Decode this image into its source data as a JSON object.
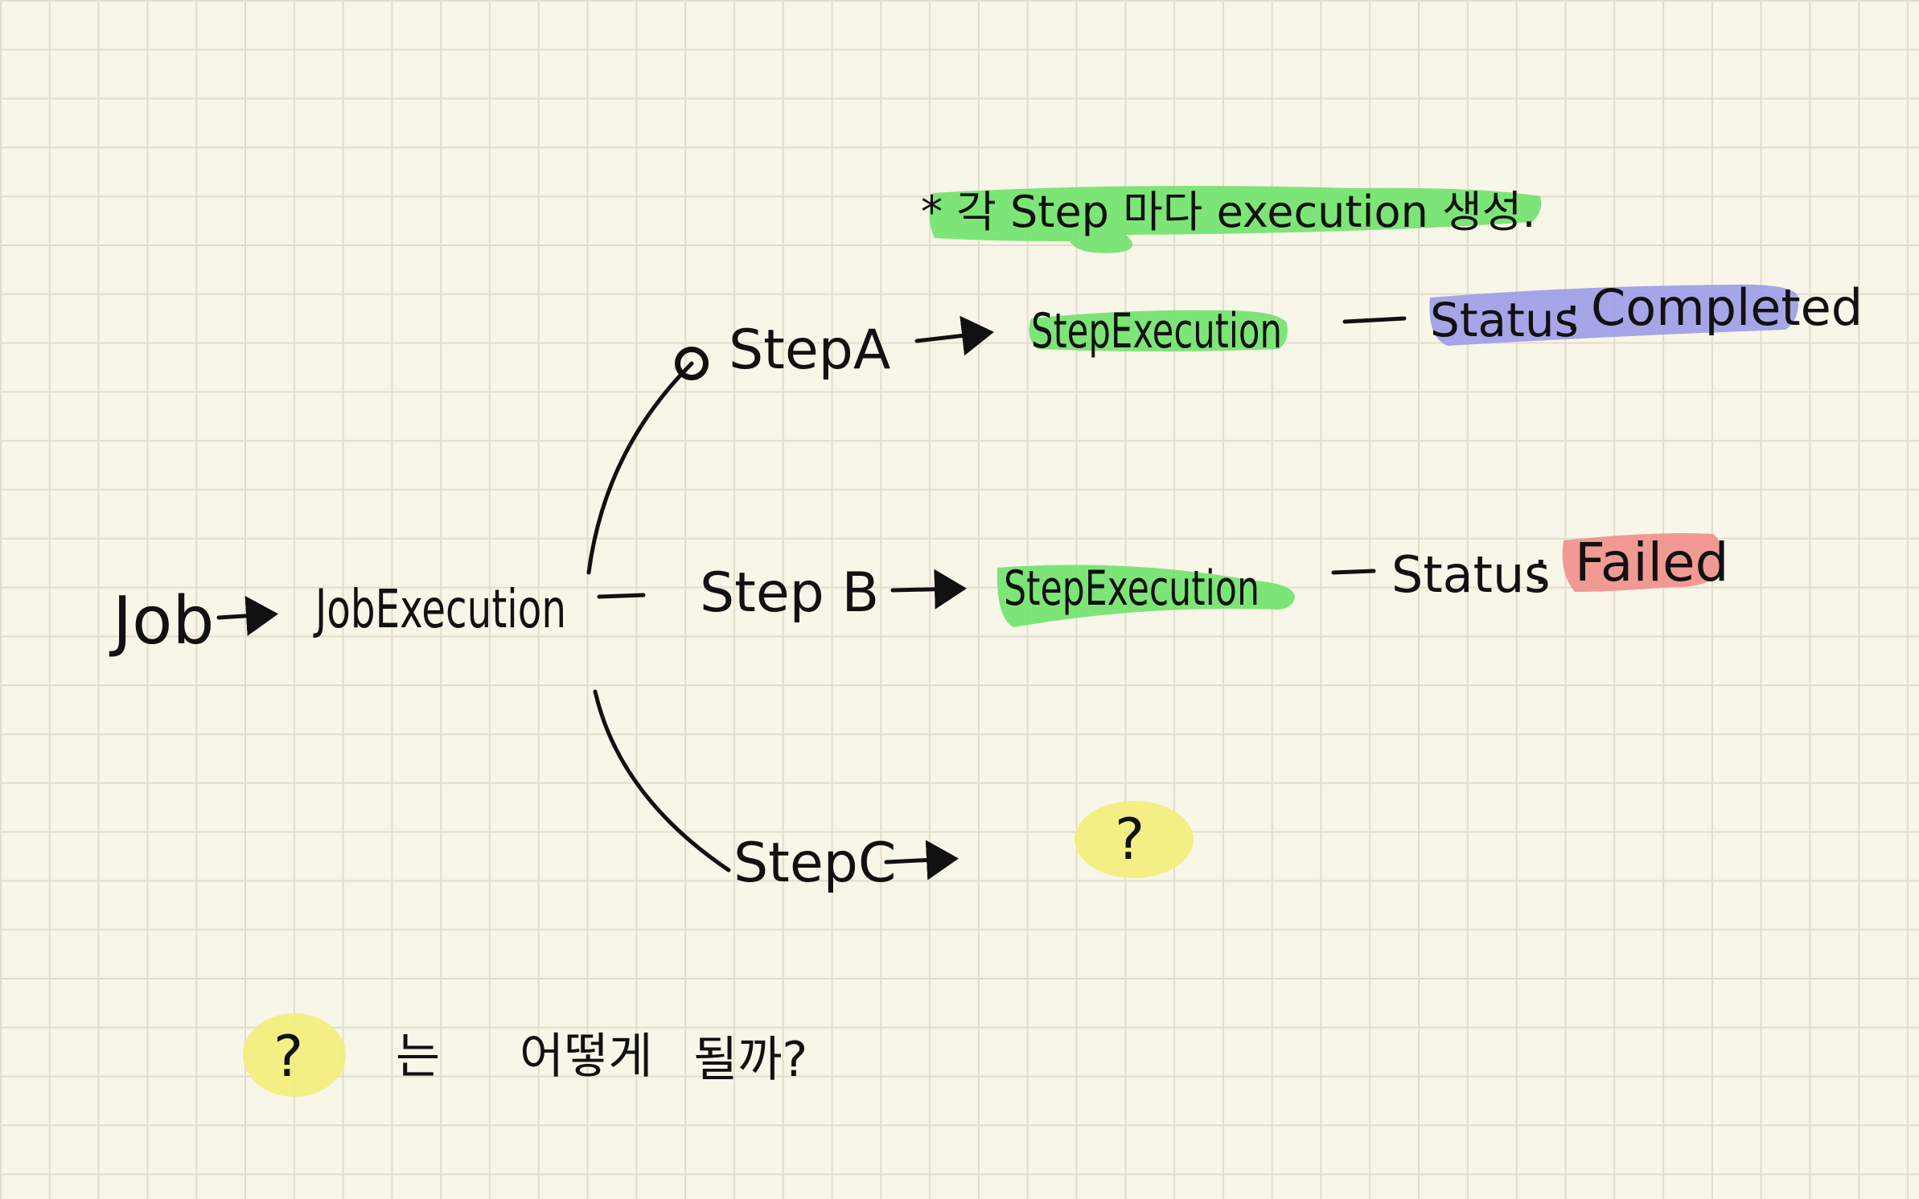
{
  "colors": {
    "ink": "#111111",
    "paper": "#f8f5e9",
    "grid": "#e2ddcc",
    "highlight_green": "#6fe36a",
    "highlight_blue": "#9c9ce8",
    "highlight_red": "#f0908a",
    "highlight_yellow": "#f2ee7a"
  },
  "note": {
    "top": "* 각 Step 마다 execution 생성.",
    "bottom_mark": "?",
    "bottom_text_1": "는",
    "bottom_text_2": "어떻게",
    "bottom_text_3": "될까?"
  },
  "nodes": {
    "job": "Job",
    "job_execution": "JobExecution",
    "step_a": "StepA",
    "step_b": "Step B",
    "step_c": "StepC",
    "step_execution_a": "StepExecution",
    "step_execution_b": "StepExecution",
    "unknown": "?"
  },
  "statuses": {
    "a": {
      "label": "Status",
      "separator": ":",
      "value": "Completed"
    },
    "b": {
      "label": "Status",
      "separator": ":",
      "value": "Failed"
    }
  }
}
